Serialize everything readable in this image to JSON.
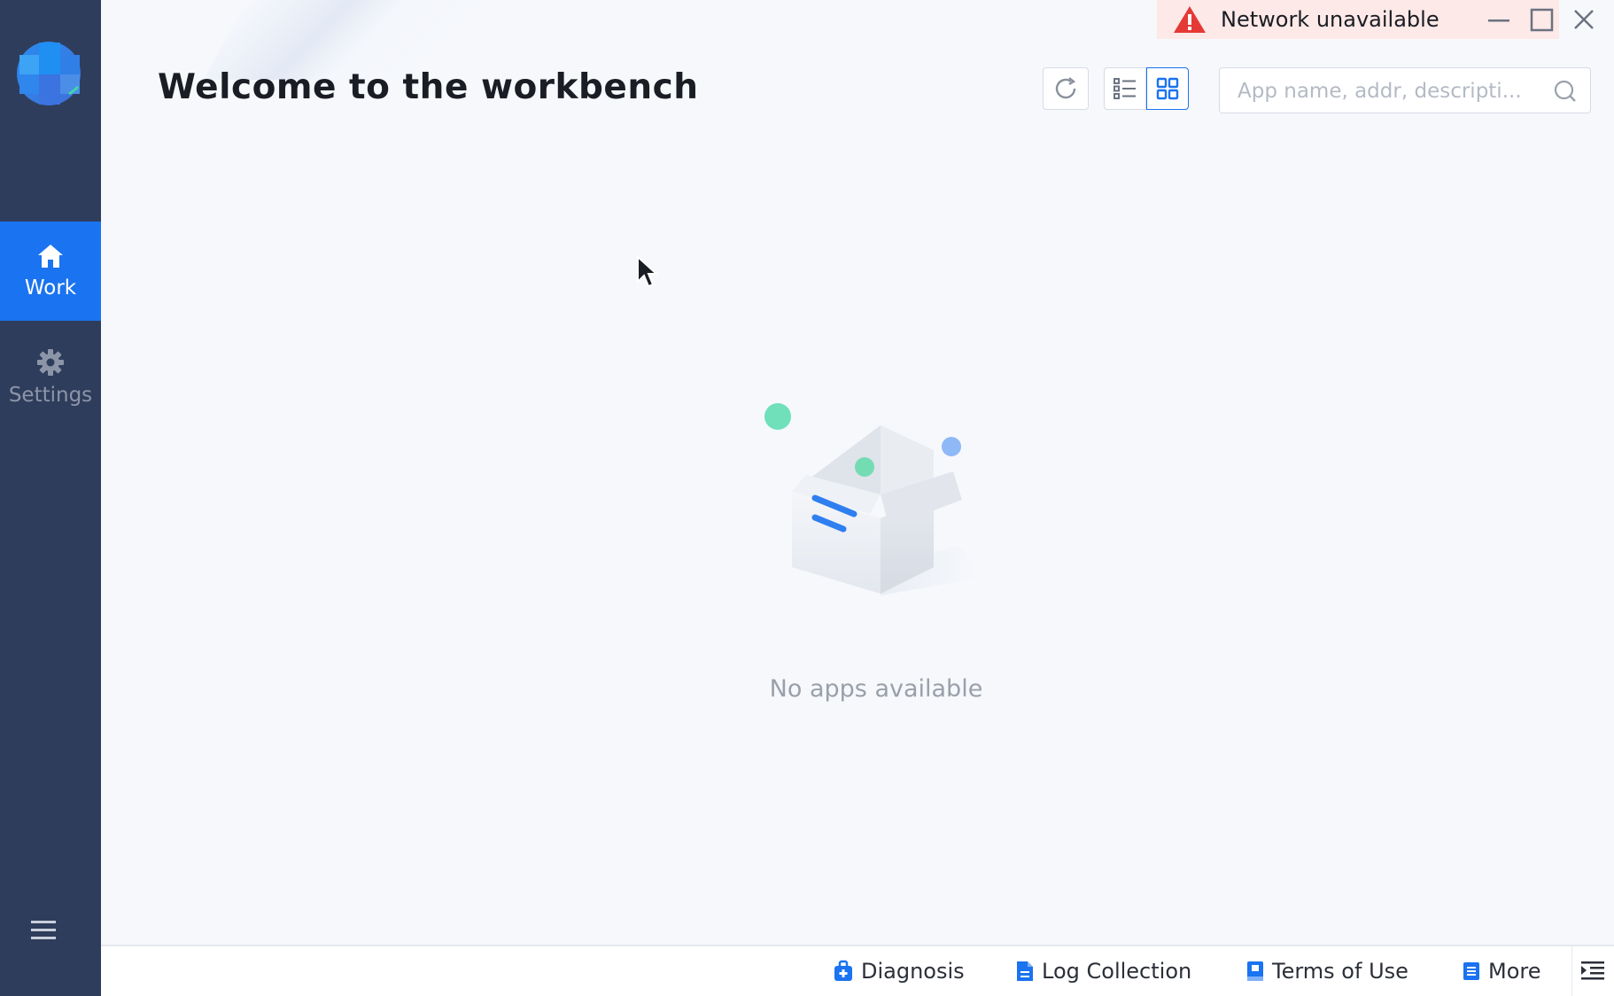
{
  "app": {
    "title": "Welcome to the workbench",
    "accent_color": "#1a73f0",
    "sidebar_color": "#2f3d5c"
  },
  "sidebar": {
    "logo_icon": "app-logo",
    "items": [
      {
        "label": "Work",
        "icon": "home-icon",
        "active": true
      },
      {
        "label": "Settings",
        "icon": "gear-icon",
        "active": false
      }
    ],
    "menu_icon": "hamburger-menu-icon"
  },
  "notification": {
    "icon": "warning-icon",
    "text": "Network unavailable",
    "color": "#e53935"
  },
  "window_controls": {
    "minimize_icon": "minimize-icon",
    "maximize_icon": "maximize-icon",
    "close_icon": "close-icon"
  },
  "toolbar": {
    "refresh_icon": "refresh-icon",
    "list_view_icon": "list-view-icon",
    "grid_view_icon": "grid-view-icon",
    "active_view": "grid"
  },
  "search": {
    "placeholder": "App name, addr, descripti...",
    "value": "",
    "icon": "search-icon"
  },
  "empty_state": {
    "illustration": "empty-box-illustration",
    "message": "No apps available"
  },
  "footer": {
    "links": [
      {
        "label": "Diagnosis",
        "icon": "diagnosis-icon"
      },
      {
        "label": "Log Collection",
        "icon": "document-icon"
      },
      {
        "label": "Terms of Use",
        "icon": "book-icon"
      },
      {
        "label": "More",
        "icon": "more-list-icon"
      }
    ],
    "end_icon": "collapse-panel-icon"
  }
}
